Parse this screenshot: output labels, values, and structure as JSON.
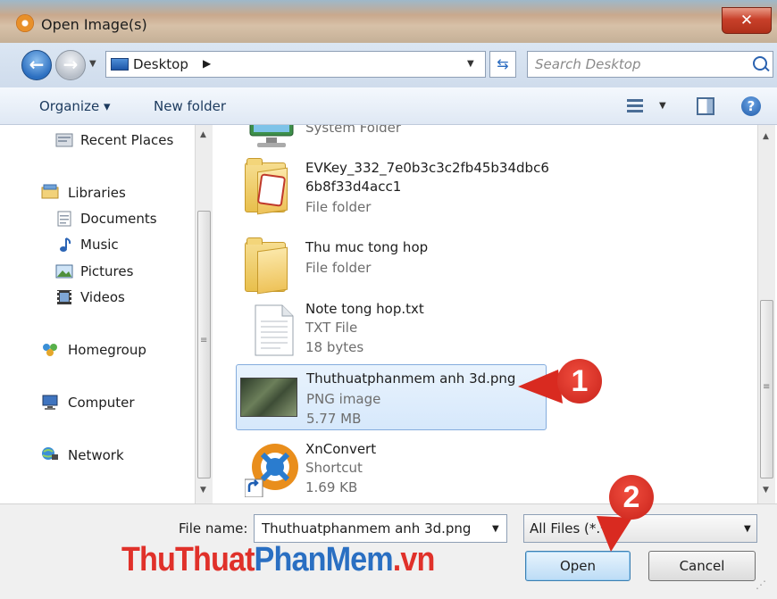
{
  "window": {
    "title": "Open Image(s)",
    "close_glyph": "✕"
  },
  "address": {
    "location": "Desktop",
    "separator": "▶",
    "search_placeholder": "Search Desktop"
  },
  "toolbar": {
    "organize": "Organize ▾",
    "new_folder": "New folder",
    "view_drop": "▼",
    "help_glyph": "?"
  },
  "nav": {
    "items": [
      {
        "label": "Recent Places",
        "icon": "recent-places-icon"
      },
      {
        "label": "Libraries",
        "icon": "libraries-icon"
      },
      {
        "label": "Documents",
        "icon": "documents-icon"
      },
      {
        "label": "Music",
        "icon": "music-icon"
      },
      {
        "label": "Pictures",
        "icon": "pictures-icon"
      },
      {
        "label": "Videos",
        "icon": "videos-icon"
      },
      {
        "label": "Homegroup",
        "icon": "homegroup-icon"
      },
      {
        "label": "Computer",
        "icon": "computer-icon"
      },
      {
        "label": "Network",
        "icon": "network-icon"
      }
    ]
  },
  "files": [
    {
      "name": "",
      "type": "System Folder",
      "size": "",
      "icon": "computer-icon"
    },
    {
      "name": "EVKey_332_7e0b3c3c2fb45b34dbc6 6b8f33d4acc1",
      "type": "File folder",
      "size": "",
      "icon": "folder-icon"
    },
    {
      "name": "Thu muc tong hop",
      "type": "File folder",
      "size": "",
      "icon": "folder-icon"
    },
    {
      "name": "Note tong hop.txt",
      "type": "TXT File",
      "size": "18 bytes",
      "icon": "text-file-icon"
    },
    {
      "name": "Thuthuatphanmem anh 3d.png",
      "type": "PNG image",
      "size": "5.77 MB",
      "icon": "image-thumbnail-icon",
      "selected": true
    },
    {
      "name": "XnConvert",
      "type": "Shortcut",
      "size": "1.69 KB",
      "icon": "xnconvert-icon"
    }
  ],
  "bottom": {
    "file_name_label": "File name:",
    "file_name_value": "Thuthuatphanmem anh 3d.png",
    "filter_value": "All Files (*.*)",
    "open_label": "Open",
    "cancel_label": "Cancel"
  },
  "watermark": {
    "part1": "ThuThuat",
    "part2": "PhanMem",
    "part3": ".vn"
  },
  "callouts": {
    "one": "1",
    "two": "2"
  },
  "colors": {
    "callout_red": "#e0312a",
    "selection_blue": "#d6e8fb",
    "watermark_blue": "#2a6fc2"
  }
}
